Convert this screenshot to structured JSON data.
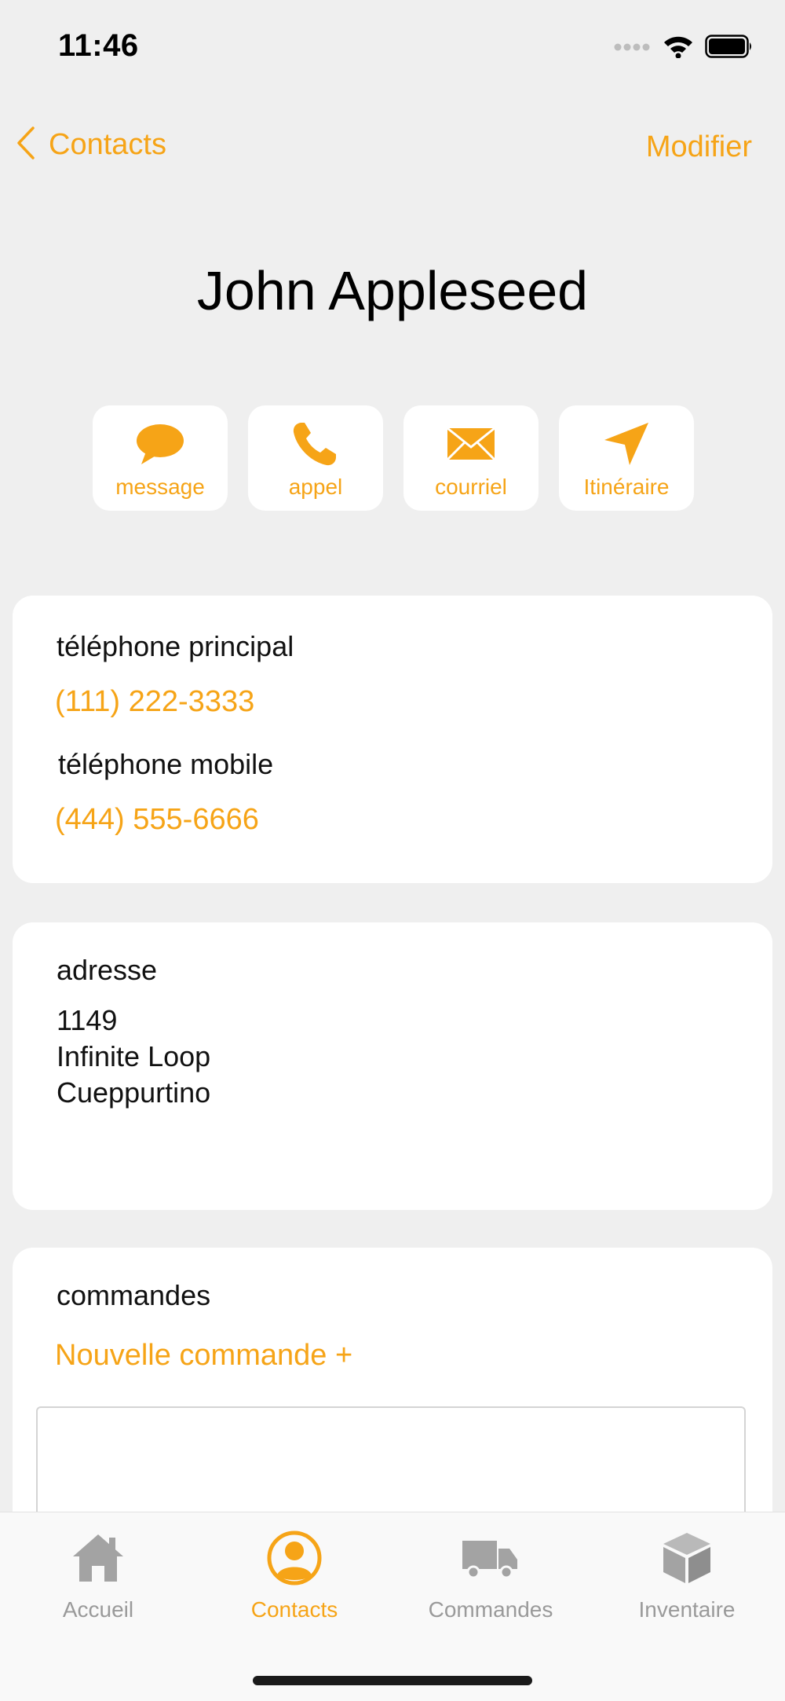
{
  "status_bar": {
    "time": "11:46",
    "signal_icon": "signal-dots-icon",
    "wifi_icon": "wifi-icon",
    "battery_icon": "battery-icon"
  },
  "nav": {
    "back_label": "Contacts",
    "edit_label": "Modifier"
  },
  "contact": {
    "name": "John Appleseed"
  },
  "actions": [
    {
      "label": "message",
      "icon": "message-bubble-icon"
    },
    {
      "label": "appel",
      "icon": "phone-icon"
    },
    {
      "label": "courriel",
      "icon": "envelope-icon"
    },
    {
      "label": "Itinéraire",
      "icon": "location-arrow-icon"
    }
  ],
  "phones": {
    "main_label": "téléphone principal",
    "main_value": "(111) 222-3333",
    "mobile_label": "téléphone mobile",
    "mobile_value": "(444) 555-6666"
  },
  "address": {
    "label": "adresse",
    "line1": "1149",
    "line2": "Infinite Loop",
    "line3": "Cueppurtino"
  },
  "orders": {
    "label": "commandes",
    "new_order": "Nouvelle commande +"
  },
  "tabs": [
    {
      "label": "Accueil",
      "icon": "house-icon",
      "active": false
    },
    {
      "label": "Contacts",
      "icon": "person-circle-icon",
      "active": true
    },
    {
      "label": "Commandes",
      "icon": "truck-icon",
      "active": false
    },
    {
      "label": "Inventaire",
      "icon": "package-icon",
      "active": false
    }
  ],
  "colors": {
    "accent": "#f6a417",
    "background": "#efefef",
    "card": "#ffffff",
    "inactive_tab": "#9a9a9a"
  }
}
